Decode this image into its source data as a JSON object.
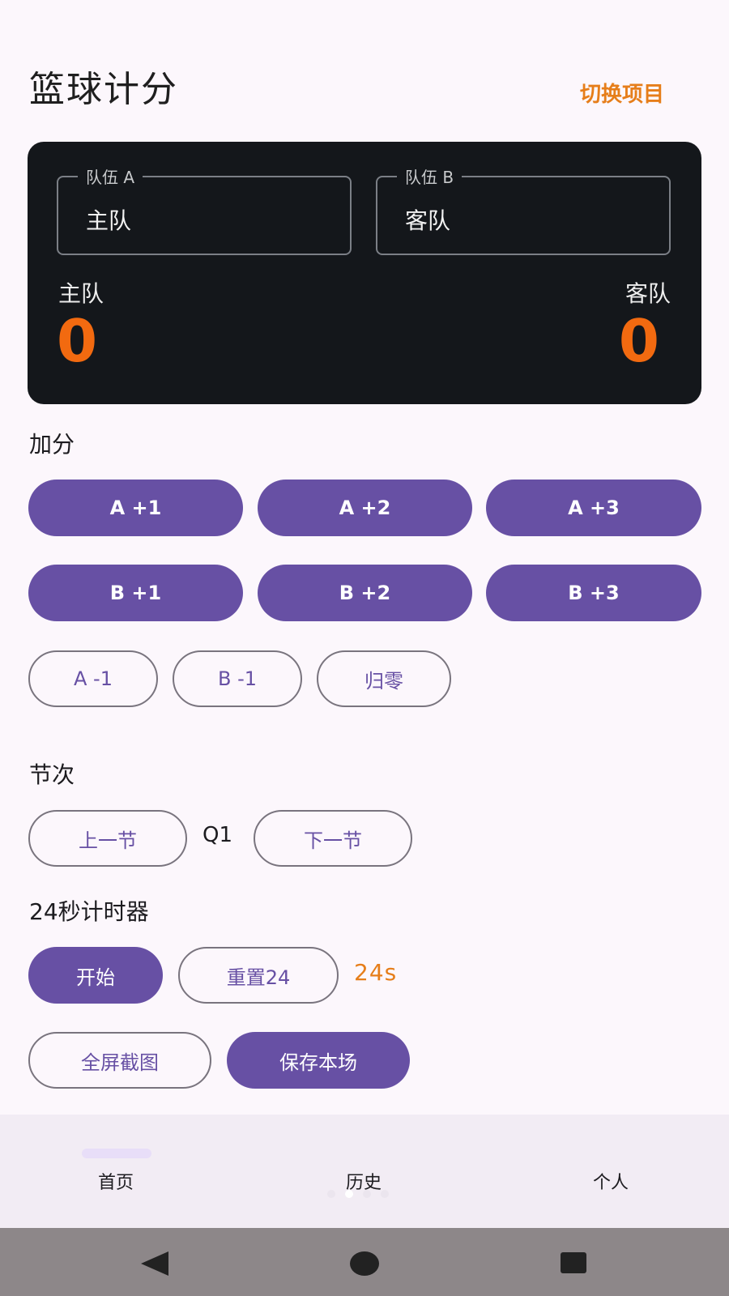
{
  "header": {
    "title": "篮球计分",
    "switch_label": "切换项目"
  },
  "score_card": {
    "team_a_field_label": "队伍 A",
    "team_a_field_value": "主队",
    "team_b_field_label": "队伍 B",
    "team_b_field_value": "客队",
    "team_a_name": "主队",
    "team_b_name": "客队",
    "team_a_score": "0",
    "team_b_score": "0"
  },
  "add_points": {
    "title": "加分",
    "a_plus_1": "A +1",
    "a_plus_2": "A +2",
    "a_plus_3": "A +3",
    "b_plus_1": "B +1",
    "b_plus_2": "B +2",
    "b_plus_3": "B +3",
    "a_minus_1": "A -1",
    "b_minus_1": "B -1",
    "reset": "归零"
  },
  "quarter": {
    "title": "节次",
    "prev_label": "上一节",
    "current": "Q1",
    "next_label": "下一节"
  },
  "shot_clock": {
    "title": "24秒计时器",
    "start_label": "开始",
    "reset_label": "重置24",
    "remaining": "24s"
  },
  "actions": {
    "screenshot_label": "全屏截图",
    "save_label": "保存本场"
  },
  "bottom_nav": {
    "home": "首页",
    "history": "历史",
    "profile": "个人"
  },
  "colors": {
    "accent_purple": "#6750a4",
    "score_orange": "#f26a10",
    "link_orange": "#e67e1a",
    "card_bg": "#14171b"
  },
  "icons": {
    "back": "back-triangle-icon",
    "home": "home-circle-icon",
    "recents": "recents-square-icon"
  }
}
